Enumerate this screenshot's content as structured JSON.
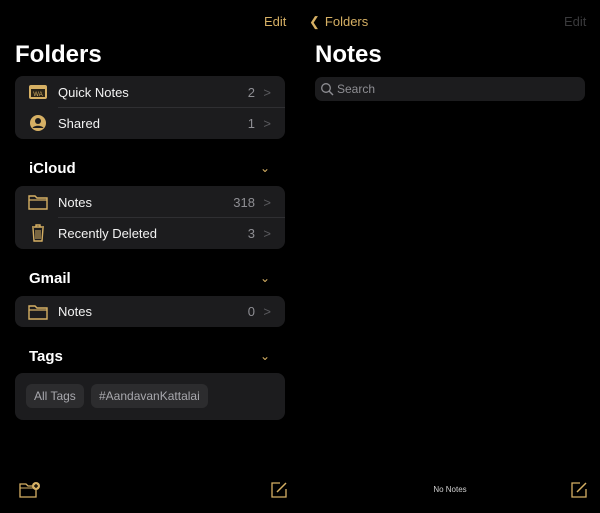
{
  "folders_panel": {
    "edit_label": "Edit",
    "title": "Folders",
    "top_items": [
      {
        "label": "Quick Notes",
        "count": "2",
        "icon": "quick-notes-icon"
      },
      {
        "label": "Shared",
        "count": "1",
        "icon": "shared-person-icon"
      }
    ],
    "sections": [
      {
        "title": "iCloud",
        "items": [
          {
            "label": "Notes",
            "count": "318",
            "icon": "folder-icon"
          },
          {
            "label": "Recently Deleted",
            "count": "3",
            "icon": "trash-icon"
          }
        ]
      },
      {
        "title": "Gmail",
        "items": [
          {
            "label": "Notes",
            "count": "0",
            "icon": "folder-icon"
          }
        ]
      }
    ],
    "tags": {
      "title": "Tags",
      "chips": [
        "All Tags",
        "#AandavanKattalai"
      ]
    }
  },
  "notes_panel": {
    "back_label": "Folders",
    "edit_label": "Edit",
    "title": "Notes",
    "search_placeholder": "Search",
    "status": "No Notes"
  },
  "colors": {
    "accent": "#d6b064",
    "background": "#000000",
    "card": "#1c1c1e"
  }
}
